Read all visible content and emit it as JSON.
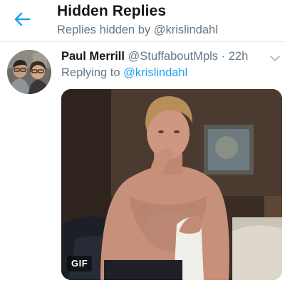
{
  "header": {
    "title": "Hidden Replies",
    "subtitle": "Replies hidden by @krislindahl",
    "back_icon": "back-arrow-icon"
  },
  "tweet": {
    "author_name": "Paul Merrill",
    "author_handle": "@StuffaboutMpls",
    "separator": "·",
    "time": "22h",
    "replying_prefix": "Replying to",
    "replying_to": "@krislindahl",
    "media_badge": "GIF"
  },
  "colors": {
    "accent": "#1da1f2",
    "text_primary": "#14171a",
    "text_secondary": "#657786",
    "divider": "#e6ecf0"
  }
}
